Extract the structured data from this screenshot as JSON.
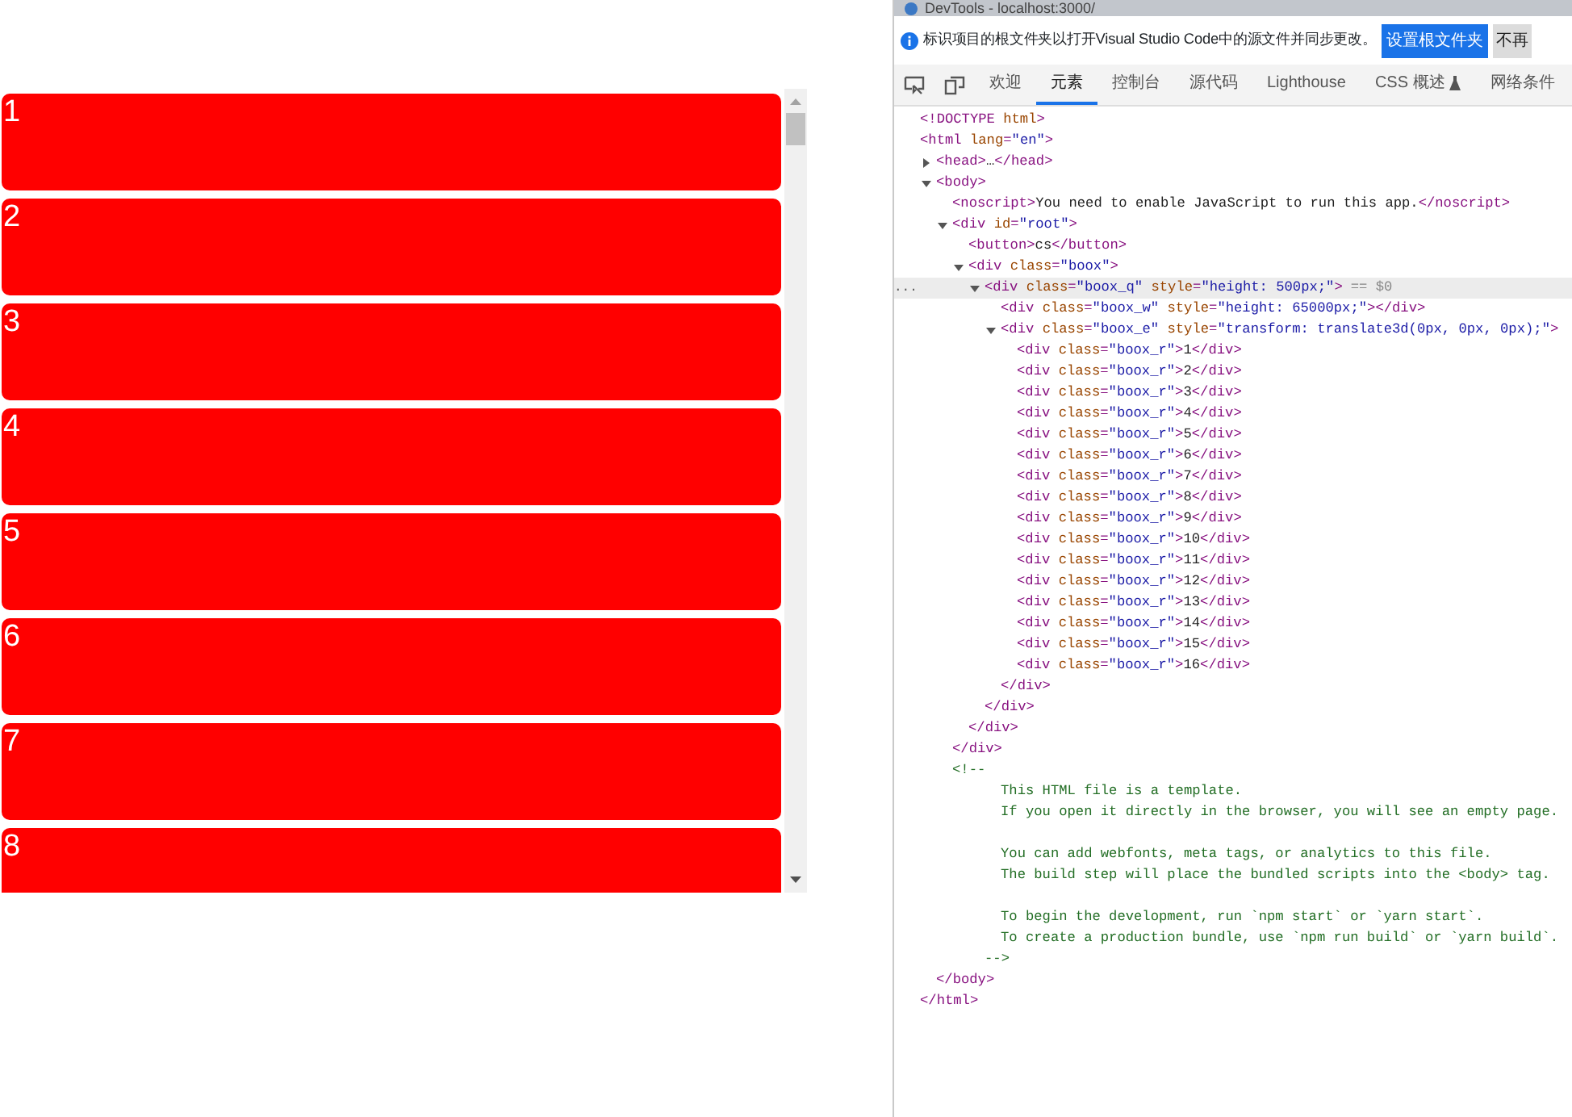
{
  "page": {
    "list": {
      "rows": [
        {
          "label": "1"
        },
        {
          "label": "2"
        },
        {
          "label": "3"
        },
        {
          "label": "4"
        },
        {
          "label": "5"
        },
        {
          "label": "6"
        },
        {
          "label": "7"
        },
        {
          "label": "8"
        }
      ]
    }
  },
  "devtools": {
    "window": {
      "title": "DevTools - localhost:3000/"
    },
    "infobar": {
      "message": "标识项目的根文件夹以打开Visual Studio Code中的源文件并同步更改。",
      "buttons": [
        {
          "label": "设置根文件夹",
          "kind": "primary"
        },
        {
          "label": "不再",
          "kind": "secondary"
        }
      ]
    },
    "tabs": [
      {
        "label": "欢迎",
        "selected": false
      },
      {
        "label": "元素",
        "selected": true
      },
      {
        "label": "控制台",
        "selected": false
      },
      {
        "label": "源代码",
        "selected": false
      },
      {
        "label": "Lighthouse",
        "selected": false
      },
      {
        "label": "CSS 概述",
        "selected": false,
        "experimental": true
      },
      {
        "label": "网络条件",
        "selected": false
      }
    ],
    "dom": [
      {
        "text": "<!DOCTYPE html>"
      },
      {
        "text": "<html lang=\"en\">",
        "close": "</html>",
        "children": [
          {
            "text": "<head>…</head>",
            "expanded": false
          },
          {
            "text": "<body>",
            "expanded": true,
            "close": "</body>",
            "children": [
              {
                "text": "<noscript>You need to enable JavaScript to run this app.</noscript>"
              },
              {
                "text": "<div id=\"root\">",
                "expanded": true,
                "close": "</div>",
                "children": [
                  {
                    "text": "<button>cs</button>"
                  },
                  {
                    "text": "<div class=\"boox\">",
                    "expanded": true,
                    "close": "</div>",
                    "children": [
                      {
                        "text": "<div class=\"boox_q\" style=\"height: 500px;\">",
                        "expanded": true,
                        "selected": true,
                        "gutter": "...",
                        "marker": "== $0",
                        "close": "</div>",
                        "children": [
                          {
                            "text": "<div class=\"boox_w\" style=\"height: 65000px;\"></div>"
                          },
                          {
                            "text": "<div class=\"boox_e\" style=\"transform: translate3d(0px, 0px, 0px);\">",
                            "expanded": true,
                            "close": "</div>",
                            "children": [
                              {
                                "text": "<div class=\"boox_r\">1</div>"
                              },
                              {
                                "text": "<div class=\"boox_r\">2</div>"
                              },
                              {
                                "text": "<div class=\"boox_r\">3</div>"
                              },
                              {
                                "text": "<div class=\"boox_r\">4</div>"
                              },
                              {
                                "text": "<div class=\"boox_r\">5</div>"
                              },
                              {
                                "text": "<div class=\"boox_r\">6</div>"
                              },
                              {
                                "text": "<div class=\"boox_r\">7</div>"
                              },
                              {
                                "text": "<div class=\"boox_r\">8</div>"
                              },
                              {
                                "text": "<div class=\"boox_r\">9</div>"
                              },
                              {
                                "text": "<div class=\"boox_r\">10</div>"
                              },
                              {
                                "text": "<div class=\"boox_r\">11</div>"
                              },
                              {
                                "text": "<div class=\"boox_r\">12</div>"
                              },
                              {
                                "text": "<div class=\"boox_r\">13</div>"
                              },
                              {
                                "text": "<div class=\"boox_r\">14</div>"
                              },
                              {
                                "text": "<div class=\"boox_r\">15</div>"
                              },
                              {
                                "text": "<div class=\"boox_r\">16</div>"
                              }
                            ]
                          }
                        ]
                      }
                    ]
                  }
                ]
              },
              {
                "kind": "comment",
                "text": "<!--",
                "close": "-->",
                "paragraphs": [
                  [
                    "This HTML file is a template.",
                    "If you open it directly in the browser, you will see an empty page."
                  ],
                  [
                    "You can add webfonts, meta tags, or analytics to this file.",
                    "The build step will place the bundled scripts into the <body> tag."
                  ],
                  [
                    "To begin the development, run `npm start` or `yarn start`.",
                    "To create a production bundle, use `npm run build` or `yarn build`."
                  ]
                ]
              }
            ]
          }
        ]
      }
    ]
  }
}
